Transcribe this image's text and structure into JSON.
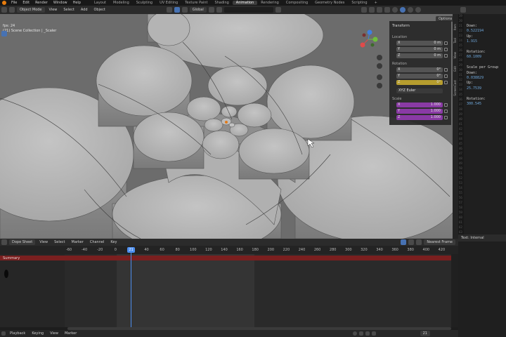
{
  "menubar": {
    "menus": [
      "File",
      "Edit",
      "Render",
      "Window",
      "Help"
    ],
    "workspaces": [
      "Layout",
      "Modeling",
      "Sculpting",
      "UV Editing",
      "Texture Paint",
      "Shading",
      "Animation",
      "Rendering",
      "Compositing",
      "Geometry Nodes",
      "Scripting",
      "+"
    ],
    "active_workspace": "Animation"
  },
  "viewport_header": {
    "mode": "Object Mode",
    "menus": [
      "View",
      "Select",
      "Add",
      "Object"
    ],
    "transform_orientation": "Global",
    "options_label": "Options"
  },
  "viewport_info": {
    "fps": "fps: 24",
    "collection": "(21) Scene Collection | _Scaler"
  },
  "npanel": {
    "transform_title": "Transform",
    "location_label": "Location",
    "location": [
      {
        "axis": "X",
        "value": "0 m"
      },
      {
        "axis": "Y",
        "value": "0 m"
      },
      {
        "axis": "Z",
        "value": "0 m"
      }
    ],
    "rotation_label": "Rotation",
    "rotation": [
      {
        "axis": "X",
        "value": "0°"
      },
      {
        "axis": "Y",
        "value": "0°"
      },
      {
        "axis": "Z",
        "value": "0°"
      }
    ],
    "rotation_mode": "XYZ Euler",
    "scale_label": "Scale",
    "scale": [
      {
        "axis": "X",
        "value": "1.000"
      },
      {
        "axis": "Y",
        "value": "1.000"
      },
      {
        "axis": "Z",
        "value": "1.000"
      }
    ],
    "tabs": [
      "Item",
      "Tool",
      "View",
      "Edit",
      "ScreenCast"
    ]
  },
  "text_panel": {
    "lines": [
      {
        "k": "Down:",
        "v": ""
      },
      {
        "k": "",
        "v": "0.522194"
      },
      {
        "k": "Up:",
        "v": ""
      },
      {
        "k": "",
        "v": "1.915"
      },
      {
        "k": "",
        "v": ""
      },
      {
        "k": "Rotation:",
        "v": ""
      },
      {
        "k": "",
        "v": "60.1009"
      },
      {
        "k": "",
        "v": ""
      },
      {
        "k": "Scale per Group",
        "v": ""
      },
      {
        "k": "Down:",
        "v": ""
      },
      {
        "k": "",
        "v": "0.038829"
      },
      {
        "k": "Up:",
        "v": ""
      },
      {
        "k": "",
        "v": "25.7539"
      },
      {
        "k": "",
        "v": ""
      },
      {
        "k": "Rotation:",
        "v": ""
      },
      {
        "k": "",
        "v": "300.545"
      }
    ],
    "gutter": [
      "19",
      "20",
      "21",
      "22",
      "23",
      "24",
      "25",
      "26",
      "27",
      "28",
      "29",
      "30",
      "31",
      "32",
      "33",
      "34",
      "35",
      "36",
      "37",
      "38",
      "39",
      "40",
      "41",
      "42",
      "43",
      "44",
      "45",
      "46",
      "47",
      "48",
      "49",
      "50",
      "51",
      "52",
      "53",
      "54",
      "55",
      "56",
      "57",
      "58",
      "59",
      "60",
      "61",
      "62",
      "63",
      "64"
    ],
    "footer": "Text: Internal"
  },
  "dopesheet": {
    "editor": "Dope Sheet",
    "menus": [
      "View",
      "Select",
      "Marker",
      "Channel",
      "Key"
    ],
    "snapping": "Nearest Frame",
    "ticks": [
      -60,
      -40,
      -20,
      0,
      20,
      40,
      60,
      80,
      100,
      120,
      140,
      160,
      180,
      200,
      220,
      240,
      260,
      280,
      300,
      320,
      340,
      360,
      380,
      400,
      420
    ],
    "current_frame": "21",
    "summary_label": "Summary"
  },
  "timeline": {
    "menus": [
      "Playback",
      "Keying",
      "View",
      "Marker"
    ],
    "frame_box": "21"
  },
  "colors": {
    "accent": "#4d8ff0",
    "summary": "#7a1f1f",
    "x_axis": "#e04a4a",
    "y_axis": "#6fbf3a",
    "z_axis": "#3f7fe0"
  }
}
